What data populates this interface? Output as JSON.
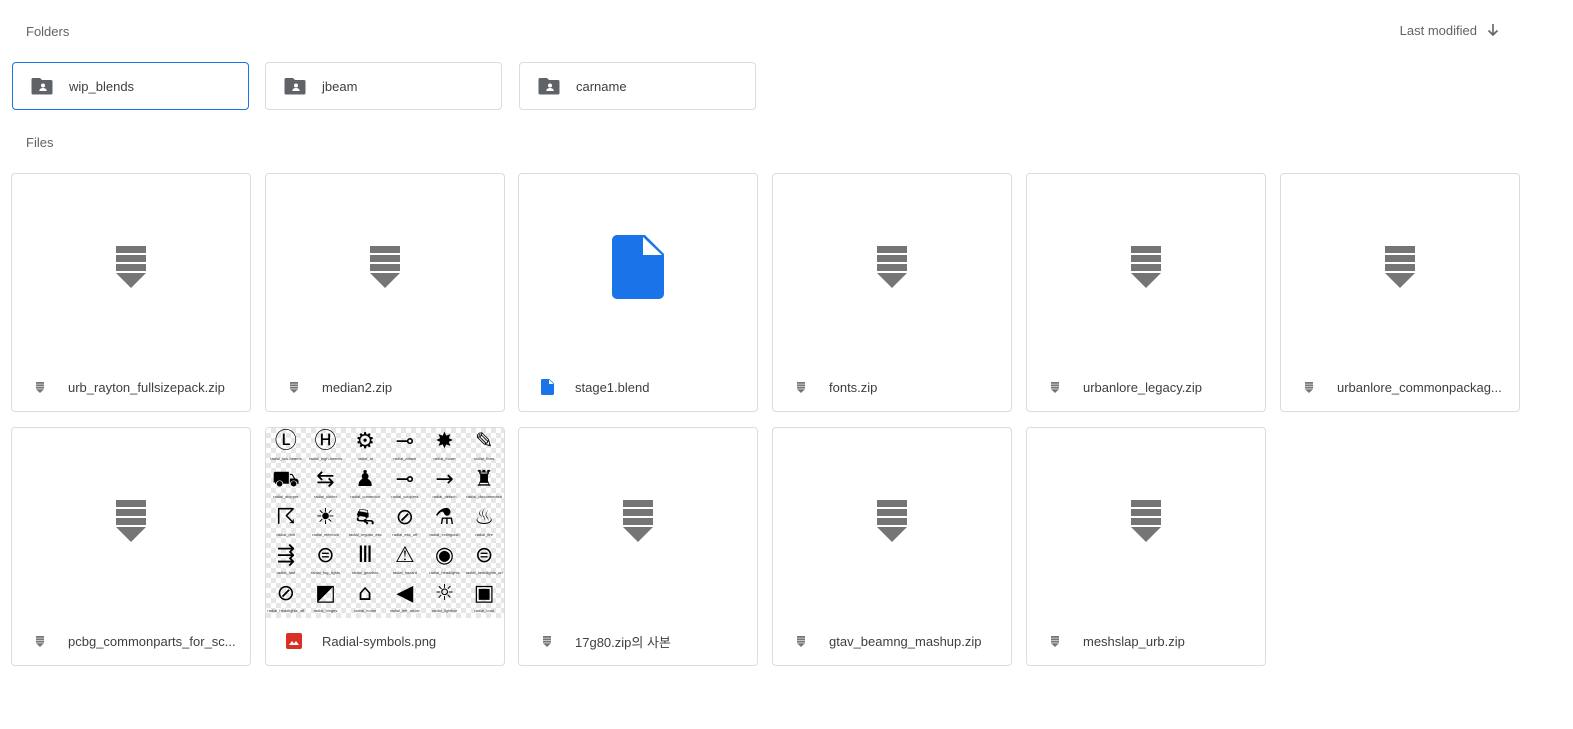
{
  "sections": {
    "folders": "Folders",
    "files": "Files"
  },
  "sort": {
    "label": "Last modified",
    "icon": "arrow-down-icon"
  },
  "folders": [
    {
      "name": "wip_blends",
      "icon": "shared-folder-icon",
      "selected": true
    },
    {
      "name": "jbeam",
      "icon": "shared-folder-icon"
    },
    {
      "name": "carname",
      "icon": "shared-folder-icon"
    }
  ],
  "files": [
    {
      "name": "urb_rayton_fullsizepack.zip",
      "type": "zip"
    },
    {
      "name": "median2.zip",
      "type": "zip"
    },
    {
      "name": "stage1.blend",
      "type": "doc"
    },
    {
      "name": "fonts.zip",
      "type": "zip"
    },
    {
      "name": "urbanlore_legacy.zip",
      "type": "zip"
    },
    {
      "name": "urbanlore_commonpackag...",
      "type": "zip"
    },
    {
      "name": "pcbg_commonparts_for_sc...",
      "type": "zip"
    },
    {
      "name": "Radial-symbols.png",
      "type": "image"
    },
    {
      "name": "17g80.zip의 사본",
      "type": "zip"
    },
    {
      "name": "gtav_beamng_mashup.zip",
      "type": "zip"
    },
    {
      "name": "meshslap_urb.zip",
      "type": "zip"
    }
  ],
  "colors": {
    "accent": "#1a73e8",
    "image_red": "#d93025",
    "zip_gray": "#757575",
    "doc_blue": "#1a73e8"
  },
  "radial_symbols": [
    {
      "glyph": "Ⓛ",
      "cap": "radial_low-beams"
    },
    {
      "glyph": "Ⓗ",
      "cap": "radial_high-beams"
    },
    {
      "glyph": "⚙",
      "cap": "radial_ai"
    },
    {
      "glyph": "⊸",
      "cap": "radial_attach"
    },
    {
      "glyph": "✸",
      "cap": "radial_boom"
    },
    {
      "glyph": "✎",
      "cap": "radial_fixes"
    },
    {
      "glyph": "⛟",
      "cap": "radial_stopper"
    },
    {
      "glyph": "⇆",
      "cap": "radial_clutter"
    },
    {
      "glyph": "♟",
      "cap": "radial_connector"
    },
    {
      "glyph": "⊸",
      "cap": "radial_couplers"
    },
    {
      "glyph": "→",
      "cap": "radial_detach"
    },
    {
      "glyph": "♜",
      "cap": "radial_disconnected"
    },
    {
      "glyph": "☈",
      "cap": "radial_drift"
    },
    {
      "glyph": "☀",
      "cap": "radial_electrics"
    },
    {
      "glyph": "⛐",
      "cap": "radial_regular_esc"
    },
    {
      "glyph": "⊘",
      "cap": "radial_esc_off"
    },
    {
      "glyph": "⚗",
      "cap": "radial_extinguish"
    },
    {
      "glyph": "♨",
      "cap": "radial_fire"
    },
    {
      "glyph": "⇶",
      "cap": "radial_fast"
    },
    {
      "glyph": "⊜",
      "cap": "radial_fog_lights"
    },
    {
      "glyph": "Ⅲ",
      "cap": "radial_gearbox"
    },
    {
      "glyph": "⚠",
      "cap": "radial_hazard"
    },
    {
      "glyph": "◉",
      "cap": "radial_headlights"
    },
    {
      "glyph": "⊜",
      "cap": "radial_headlights_on"
    },
    {
      "glyph": "⊘",
      "cap": "radial_headlights_off"
    },
    {
      "glyph": "◩",
      "cap": "radial_hinges"
    },
    {
      "glyph": "⌂",
      "cap": "radial_home"
    },
    {
      "glyph": "◀",
      "cap": "radial_left_arrow"
    },
    {
      "glyph": "☼",
      "cap": "radial_lightbar"
    },
    {
      "glyph": "▣",
      "cap": "radial_load"
    }
  ]
}
